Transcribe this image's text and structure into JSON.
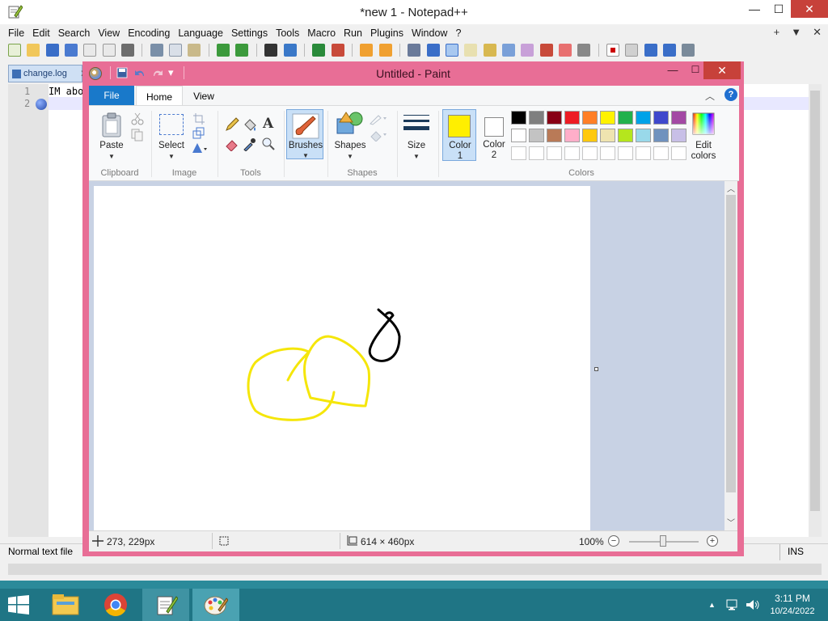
{
  "npp": {
    "title": "*new 1 - Notepad++",
    "window_controls": {
      "minimize": "—",
      "maximize": "☐",
      "close": "✕"
    },
    "menu": [
      "File",
      "Edit",
      "Search",
      "View",
      "Encoding",
      "Language",
      "Settings",
      "Tools",
      "Macro",
      "Run",
      "Plugins",
      "Window",
      "?"
    ],
    "menu_right": {
      "plus": "+",
      "down": "▼",
      "close": "✕"
    },
    "tab": {
      "label": "change.log",
      "close": "✕"
    },
    "lines": [
      "1",
      "2"
    ],
    "line1_text": "IM abo",
    "status": {
      "type": "Normal text file",
      "mode": "INS"
    }
  },
  "paint": {
    "title": "Untitled - Paint",
    "quick_access": {
      "save": "💾",
      "undo": "↶",
      "redo": "↷",
      "customize": "▾"
    },
    "window_controls": {
      "minimize": "—",
      "maximize": "☐",
      "close": "✕"
    },
    "tabs": {
      "file": "File",
      "home": "Home",
      "view": "View"
    },
    "help": "?",
    "collapse": "︿",
    "groups": {
      "clipboard": {
        "label": "Clipboard",
        "paste": "Paste"
      },
      "image": {
        "label": "Image",
        "select": "Select"
      },
      "tools": {
        "label": "Tools",
        "text_tool": "A"
      },
      "brushes": {
        "label": "Brushes"
      },
      "shapes": {
        "label": "Shapes",
        "shapes_btn": "Shapes"
      },
      "size": {
        "label": "Size"
      },
      "colors": {
        "label": "Colors",
        "color1_label": "Color",
        "color1_num": "1",
        "color2_label": "Color",
        "color2_num": "2",
        "edit_colors_1": "Edit",
        "edit_colors_2": "colors",
        "color1": "#ffef00",
        "color2": "#ffffff",
        "palette_row1": [
          "#000000",
          "#7f7f7f",
          "#880015",
          "#ed1c24",
          "#ff7f27",
          "#fff200",
          "#22b14c",
          "#00a2e8",
          "#3f48cc",
          "#a349a4"
        ],
        "palette_row2": [
          "#ffffff",
          "#c3c3c3",
          "#b97a57",
          "#ffaec9",
          "#ffc90e",
          "#efe4b0",
          "#b5e61d",
          "#99d9ea",
          "#7092be",
          "#c8bfe7"
        ]
      }
    },
    "canvas": {
      "stroke_colors": {
        "yellow": "#f5e60a",
        "black": "#000000"
      }
    },
    "status": {
      "cursor_pos": "273, 229px",
      "canvas_size": "614 × 460px",
      "zoom": "100%",
      "zoom_out": "−",
      "zoom_in": "+"
    }
  },
  "taskbar": {
    "time": "3:11 PM",
    "date": "10/24/2022",
    "tray_up": "▲"
  }
}
